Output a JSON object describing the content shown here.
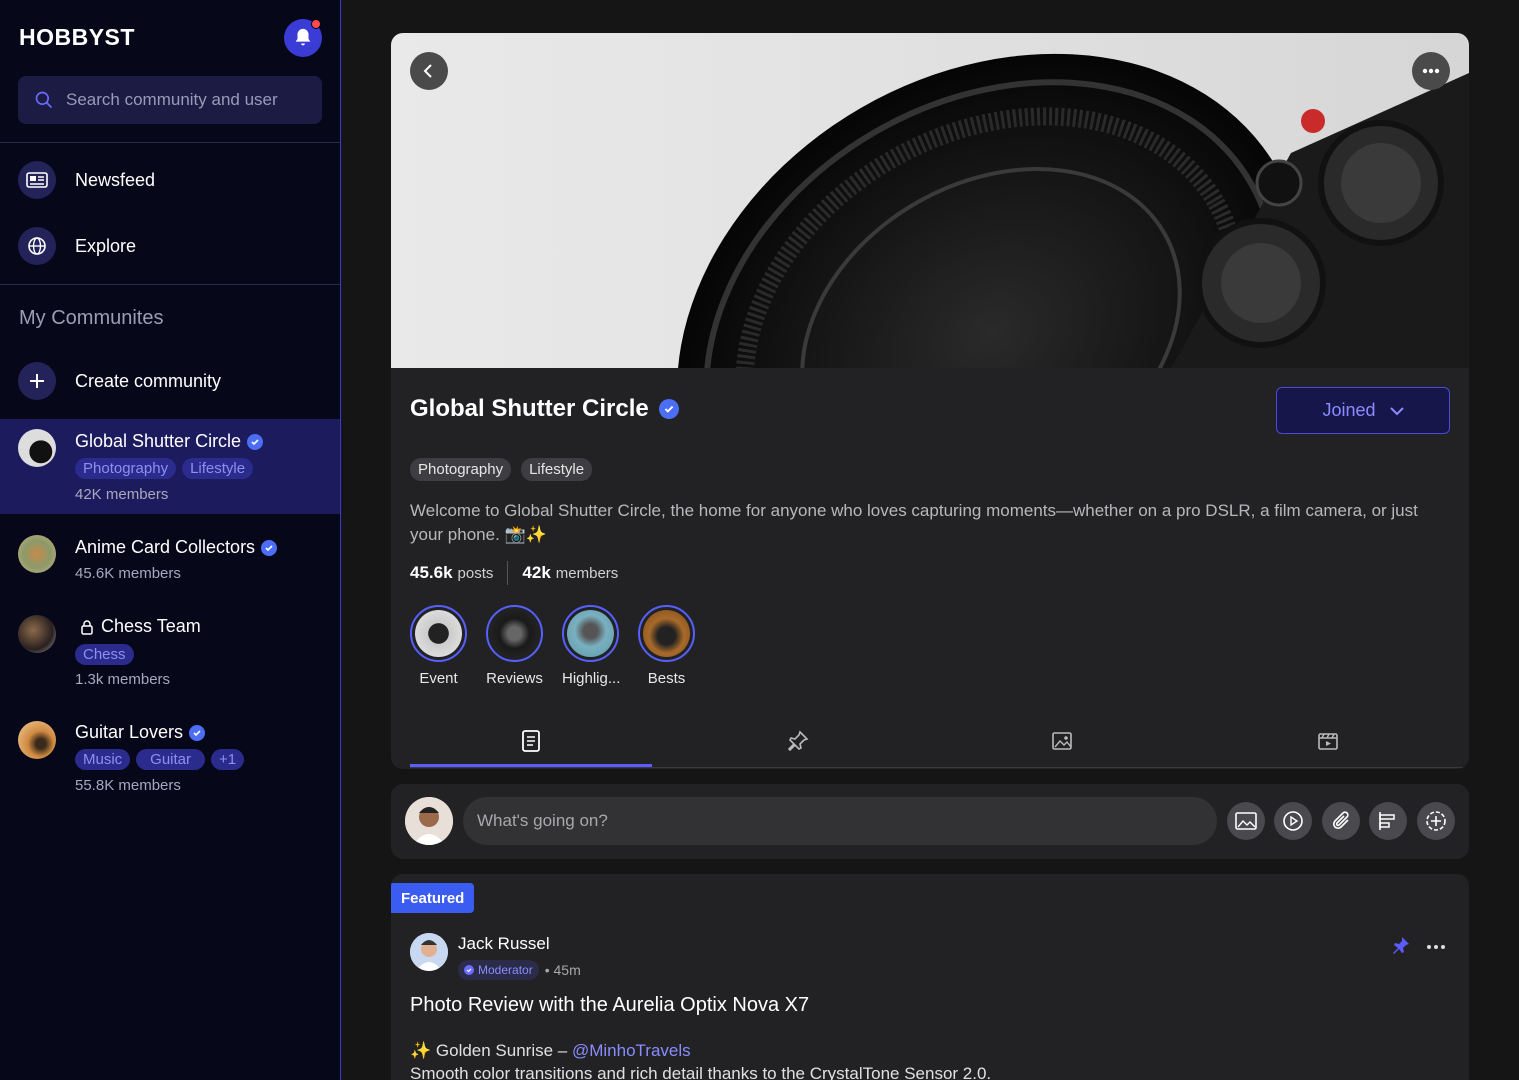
{
  "brand": "HOBBYST",
  "search": {
    "placeholder": "Search community and user"
  },
  "nav": [
    {
      "label": "Newsfeed"
    },
    {
      "label": "Explore"
    }
  ],
  "sidebar": {
    "section_title": "My Communites",
    "create_label": "Create community",
    "communities": [
      {
        "name": "Global Shutter Circle",
        "tags": [
          "Photography",
          "Lifestyle"
        ],
        "members": "42K members",
        "verified": true,
        "active": true
      },
      {
        "name": "Anime Card Collectors",
        "tags": [],
        "members": "45.6K members",
        "verified": true
      },
      {
        "name": "Chess Team",
        "tags": [
          "Chess"
        ],
        "members": "1.3k members",
        "locked": true
      },
      {
        "name": "Guitar Lovers",
        "tags": [
          "Music",
          "Guitar",
          "+1"
        ],
        "members": "55.8K members",
        "verified": true
      }
    ]
  },
  "community": {
    "title": "Global Shutter Circle",
    "joined_label": "Joined",
    "tags": [
      "Photography",
      "Lifestyle"
    ],
    "description": "Welcome to Global Shutter Circle, the home for anyone who loves capturing moments—whether on a pro DSLR, a film camera, or just your phone. 📸✨",
    "posts_count": "45.6k",
    "posts_label": "posts",
    "members_count": "42k",
    "members_label": "members",
    "highlights": [
      "Event",
      "Reviews",
      "Highlig...",
      "Bests"
    ]
  },
  "composer": {
    "placeholder": "What's going on?"
  },
  "post": {
    "badge": "Featured",
    "author": "Jack Russel",
    "role": "Moderator",
    "time": "• 45m",
    "title": "Photo Review with the Aurelia Optix Nova X7",
    "line1_prefix": "✨ Golden Sunrise – ",
    "line1_mention": "@MinhoTravels",
    "line2": "Smooth color transitions and rich detail thanks to the CrystalTone Sensor 2.0."
  },
  "colors": {
    "accent": "#4b4bd8",
    "sidebar_bg": "#07071a",
    "active_bg": "#1c1b5e",
    "card_bg": "#222224"
  }
}
